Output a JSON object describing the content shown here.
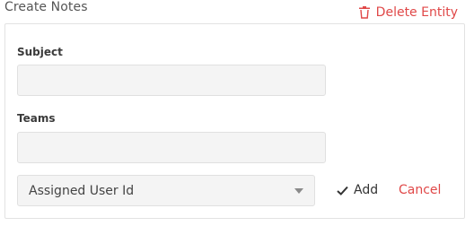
{
  "header": {
    "title": "Create Notes",
    "delete_label": "Delete Entity",
    "delete_icon": "trash-icon",
    "accent_color": "#e04848"
  },
  "form": {
    "subject": {
      "label": "Subject",
      "value": ""
    },
    "teams": {
      "label": "Teams",
      "value": ""
    },
    "assigned_user": {
      "selected": "Assigned User Id",
      "icon": "chevron-down-icon"
    }
  },
  "actions": {
    "add_label": "Add",
    "add_icon": "check-icon",
    "cancel_label": "Cancel"
  }
}
